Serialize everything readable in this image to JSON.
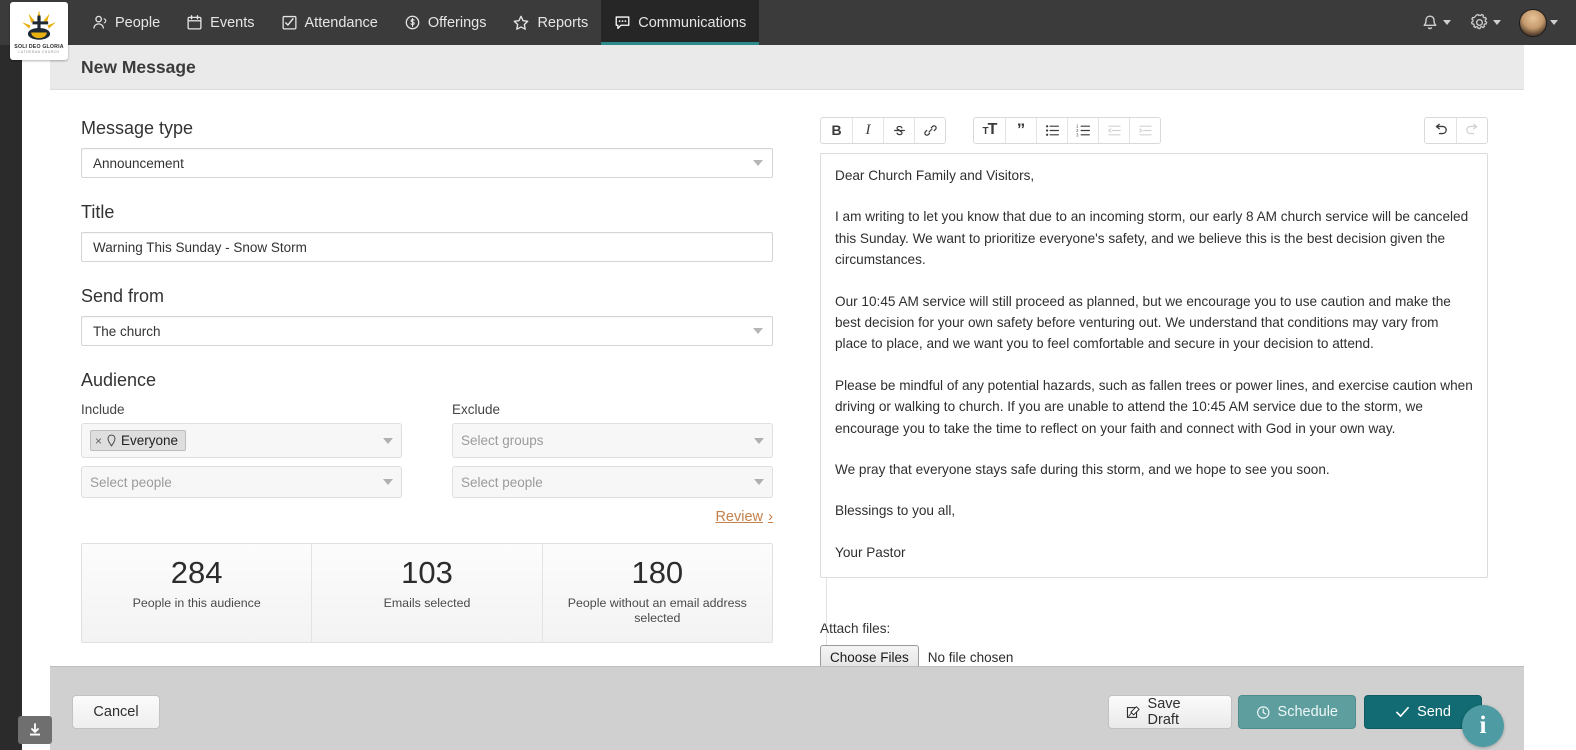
{
  "brand": {
    "logo_text": "SOLI DEO GLORIA",
    "logo_subtext": "LUTHERAN CHURCH"
  },
  "topnav": {
    "items": [
      {
        "label": "People",
        "icon": "person-icon",
        "active": false
      },
      {
        "label": "Events",
        "icon": "calendar-icon",
        "active": false
      },
      {
        "label": "Attendance",
        "icon": "checklist-icon",
        "active": false
      },
      {
        "label": "Offerings",
        "icon": "coin-icon",
        "active": false
      },
      {
        "label": "Reports",
        "icon": "star-icon",
        "active": false
      },
      {
        "label": "Communications",
        "icon": "chat-icon",
        "active": true
      }
    ],
    "right": {
      "notifications": "bell-icon",
      "settings": "gear-icon",
      "account": "avatar"
    },
    "accent": "#2e8b8b",
    "bg": "#3b3b3b"
  },
  "page": {
    "title": "New Message"
  },
  "form": {
    "message_type": {
      "label": "Message type",
      "value": "Announcement"
    },
    "title": {
      "label": "Title",
      "value": "Warning This Sunday - Snow Storm"
    },
    "send_from": {
      "label": "Send from",
      "value": "The church"
    },
    "audience": {
      "heading": "Audience",
      "include": {
        "label": "Include",
        "tags": [
          {
            "text": "Everyone",
            "remove": "×",
            "icon": "pin-icon"
          }
        ],
        "people_placeholder": "Select people"
      },
      "exclude": {
        "label": "Exclude",
        "groups_placeholder": "Select groups",
        "people_placeholder": "Select people"
      },
      "review_link": "Review",
      "review_chevron": "›"
    },
    "stats": [
      {
        "number": "284",
        "caption": "People in this audience"
      },
      {
        "number": "103",
        "caption": "Emails selected"
      },
      {
        "number": "180",
        "caption": "People without an email address selected"
      }
    ]
  },
  "editor": {
    "toolbar": {
      "group1": [
        {
          "name": "bold-icon",
          "glyph": "B",
          "disabled": false
        },
        {
          "name": "italic-icon",
          "glyph": "I",
          "disabled": false
        },
        {
          "name": "strikethrough-icon",
          "glyph": "S",
          "disabled": false
        },
        {
          "name": "link-icon",
          "glyph": "🔗",
          "disabled": false
        }
      ],
      "group2": [
        {
          "name": "text-size-icon",
          "glyph": "T",
          "disabled": false
        },
        {
          "name": "blockquote-icon",
          "glyph": "”",
          "disabled": false
        },
        {
          "name": "bulleted-list-icon",
          "glyph": "•",
          "disabled": false
        },
        {
          "name": "numbered-list-icon",
          "glyph": "1.",
          "disabled": false
        },
        {
          "name": "outdent-icon",
          "glyph": "←",
          "disabled": true
        },
        {
          "name": "indent-icon",
          "glyph": "→",
          "disabled": true
        }
      ],
      "group3": [
        {
          "name": "undo-icon",
          "glyph": "↶",
          "disabled": false
        },
        {
          "name": "redo-icon",
          "glyph": "↷",
          "disabled": true
        }
      ]
    },
    "body_paragraphs": [
      "Dear Church Family and Visitors,",
      "I am writing to let you know that due to an incoming storm, our early 8 AM church service will be canceled this Sunday. We want to prioritize everyone's safety, and we believe this is the best decision given the circumstances.",
      "Our 10:45 AM service will still proceed as planned, but we encourage you to use caution and make the best decision for your own safety before venturing out. We understand that conditions may vary from place to place, and we want you to feel comfortable and secure in your decision to attend.",
      "Please be mindful of any potential hazards, such as fallen trees or power lines, and exercise caution when driving or walking to church. If you are unable to attend the 10:45 AM service due to the storm, we encourage you to take the time to reflect on your faith and connect with God in your own way.",
      "We pray that everyone stays safe during this storm, and we hope to see you soon.",
      "Blessings to you all,",
      "Your Pastor"
    ],
    "assistant_bubble": "ai-assistant-icon"
  },
  "attach": {
    "label": "Attach files:",
    "button": "Choose Files",
    "status": "No file chosen"
  },
  "footer": {
    "cancel": "Cancel",
    "save_draft": "Save Draft",
    "schedule": "Schedule",
    "send": "Send",
    "info": "i"
  },
  "colors": {
    "teal_primary": "#126b72",
    "teal_secondary": "#5e9e9e",
    "link_orange": "#c4804a",
    "nav_bg": "#3b3b3b",
    "footer_bg": "#d0d0d0"
  }
}
